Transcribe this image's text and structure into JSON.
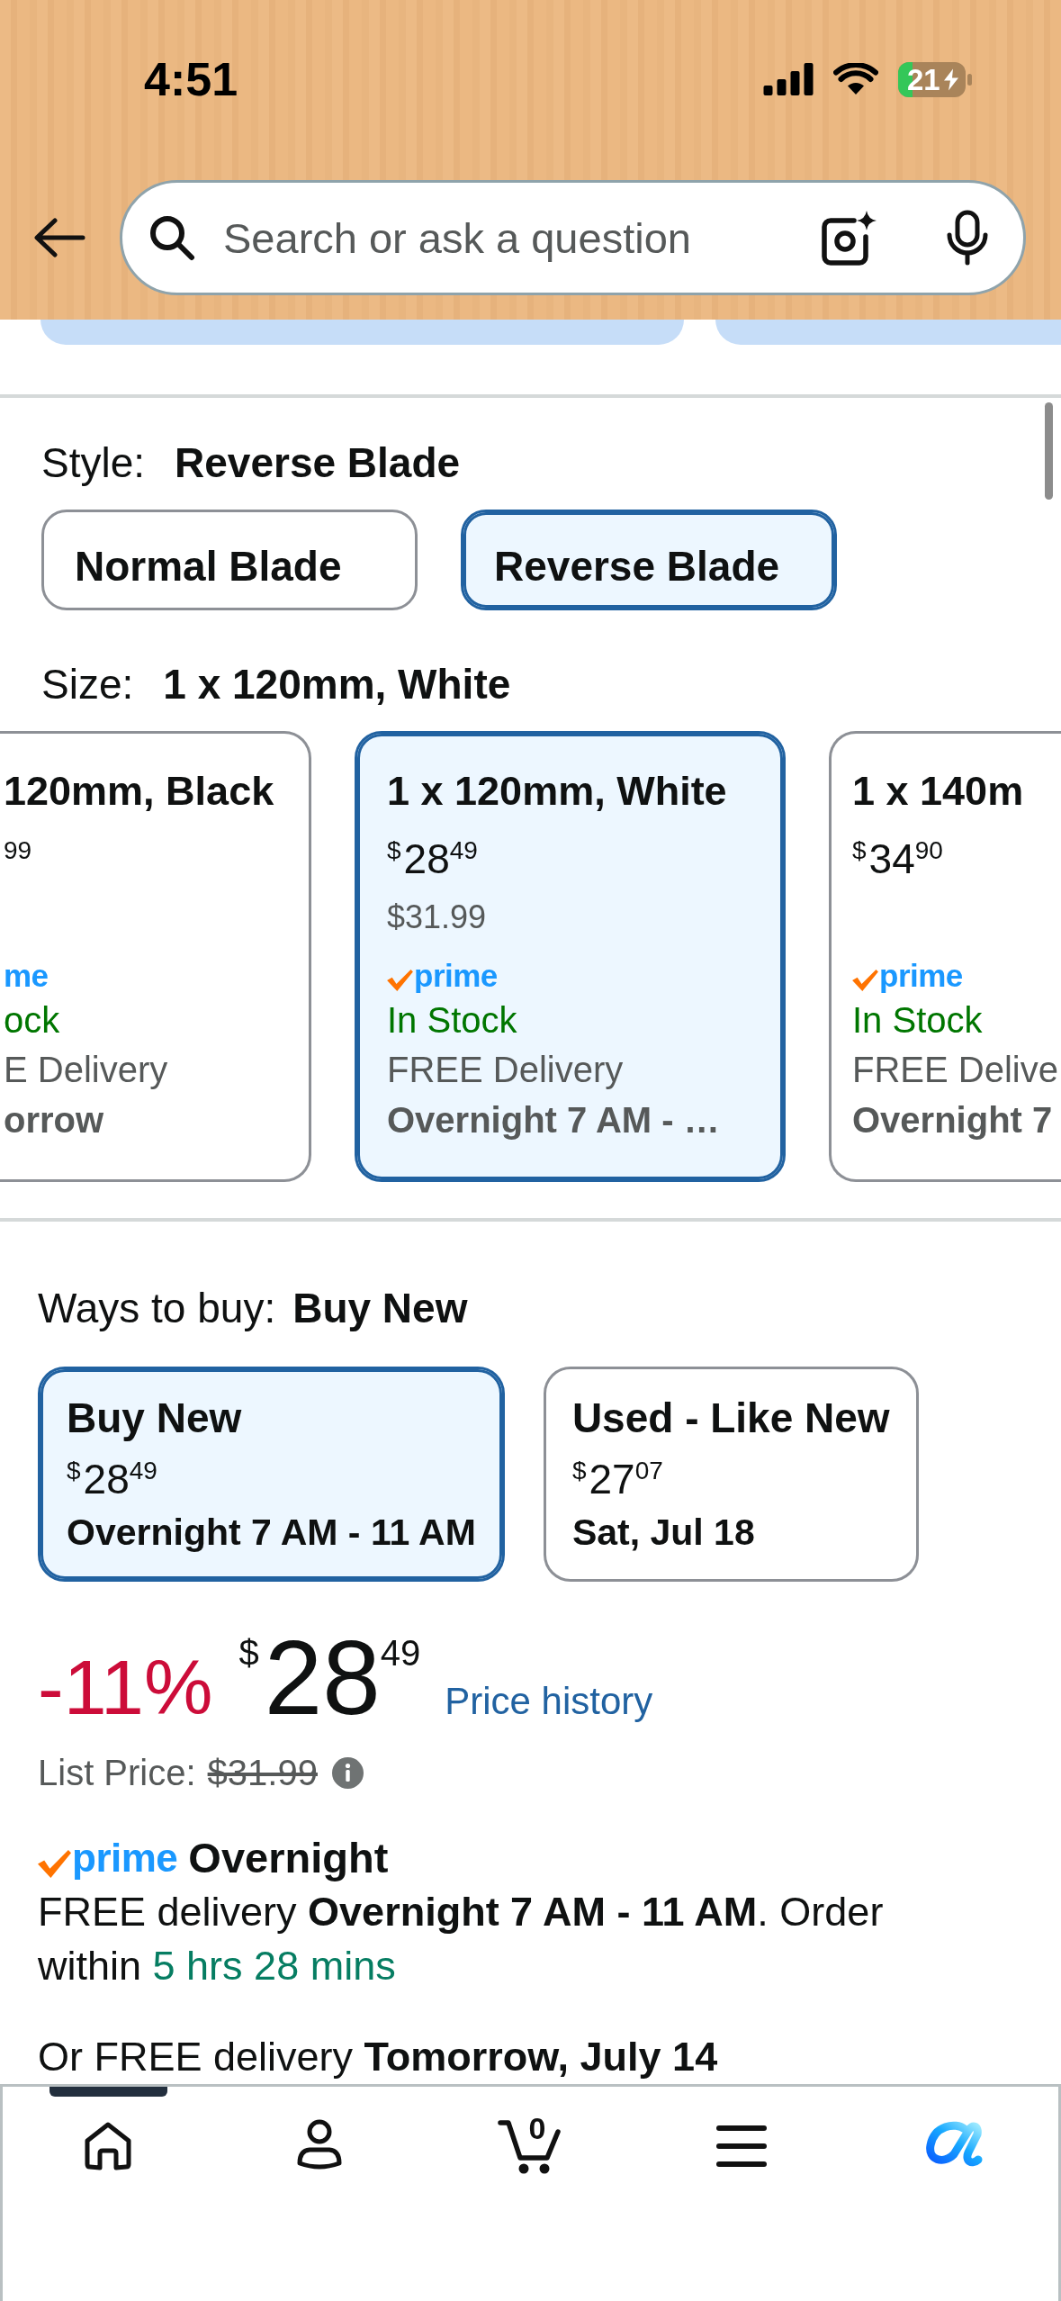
{
  "status_bar": {
    "time": "4:51",
    "battery": "21"
  },
  "search": {
    "placeholder": "Search or ask a question"
  },
  "style": {
    "label": "Style:",
    "value": "Reverse Blade",
    "options": [
      {
        "label": "Normal Blade",
        "selected": false
      },
      {
        "label": "Reverse Blade",
        "selected": true
      }
    ]
  },
  "size": {
    "label": "Size:",
    "value": "1 x 120mm, White",
    "options": [
      {
        "title": "120mm, Black",
        "price": {
          "fraction": "99"
        },
        "badge": {
          "check": false,
          "text": "me"
        },
        "stock": "ock",
        "delivery": "E Delivery",
        "date": "orrow",
        "selected": false
      },
      {
        "title": "1 x 120mm, White",
        "price": {
          "symbol": "$",
          "whole": "28",
          "fraction": "49"
        },
        "list_price": "$31.99",
        "badge": {
          "check": true,
          "text": "prime"
        },
        "stock": "In Stock",
        "delivery": "FREE Delivery",
        "date": "Overnight 7 AM - …",
        "selected": true
      },
      {
        "title": "1 x 140m",
        "price": {
          "symbol": "$",
          "whole": "34",
          "fraction": "90"
        },
        "badge": {
          "check": true,
          "text": "prime"
        },
        "stock": "In Stock",
        "delivery": "FREE Delive",
        "date": "Overnight 7",
        "selected": false
      }
    ]
  },
  "ways_to_buy": {
    "label": "Ways to buy:",
    "value": "Buy New",
    "options": [
      {
        "title": "Buy New",
        "price": {
          "symbol": "$",
          "whole": "28",
          "fraction": "49"
        },
        "date": "Overnight 7 AM - 11 AM",
        "selected": true
      },
      {
        "title": "Used - Like New",
        "price": {
          "symbol": "$",
          "whole": "27",
          "fraction": "07"
        },
        "date": "Sat, Jul 18",
        "selected": false
      }
    ]
  },
  "price": {
    "discount": "-11%",
    "symbol": "$",
    "whole": "28",
    "fraction": "49",
    "history_link": "Price history",
    "list_price_label": "List Price:",
    "list_price": "$31.99"
  },
  "delivery": {
    "badge": {
      "check": true,
      "text": "prime"
    },
    "title": "Overnight",
    "message": "FREE delivery **Overnight 7 AM - 11 AM**. Order within",
    "countdown": "5 hrs 28 mins",
    "alternative": "Or FREE delivery **Tomorrow, July 14**"
  },
  "bottom_nav": {
    "items": [
      {
        "kind": "home",
        "selected": true
      },
      {
        "kind": "account",
        "selected": false
      },
      {
        "kind": "cart",
        "count": "0",
        "selected": false
      },
      {
        "kind": "menu",
        "selected": false
      },
      {
        "kind": "assistant",
        "selected": false
      }
    ]
  }
}
